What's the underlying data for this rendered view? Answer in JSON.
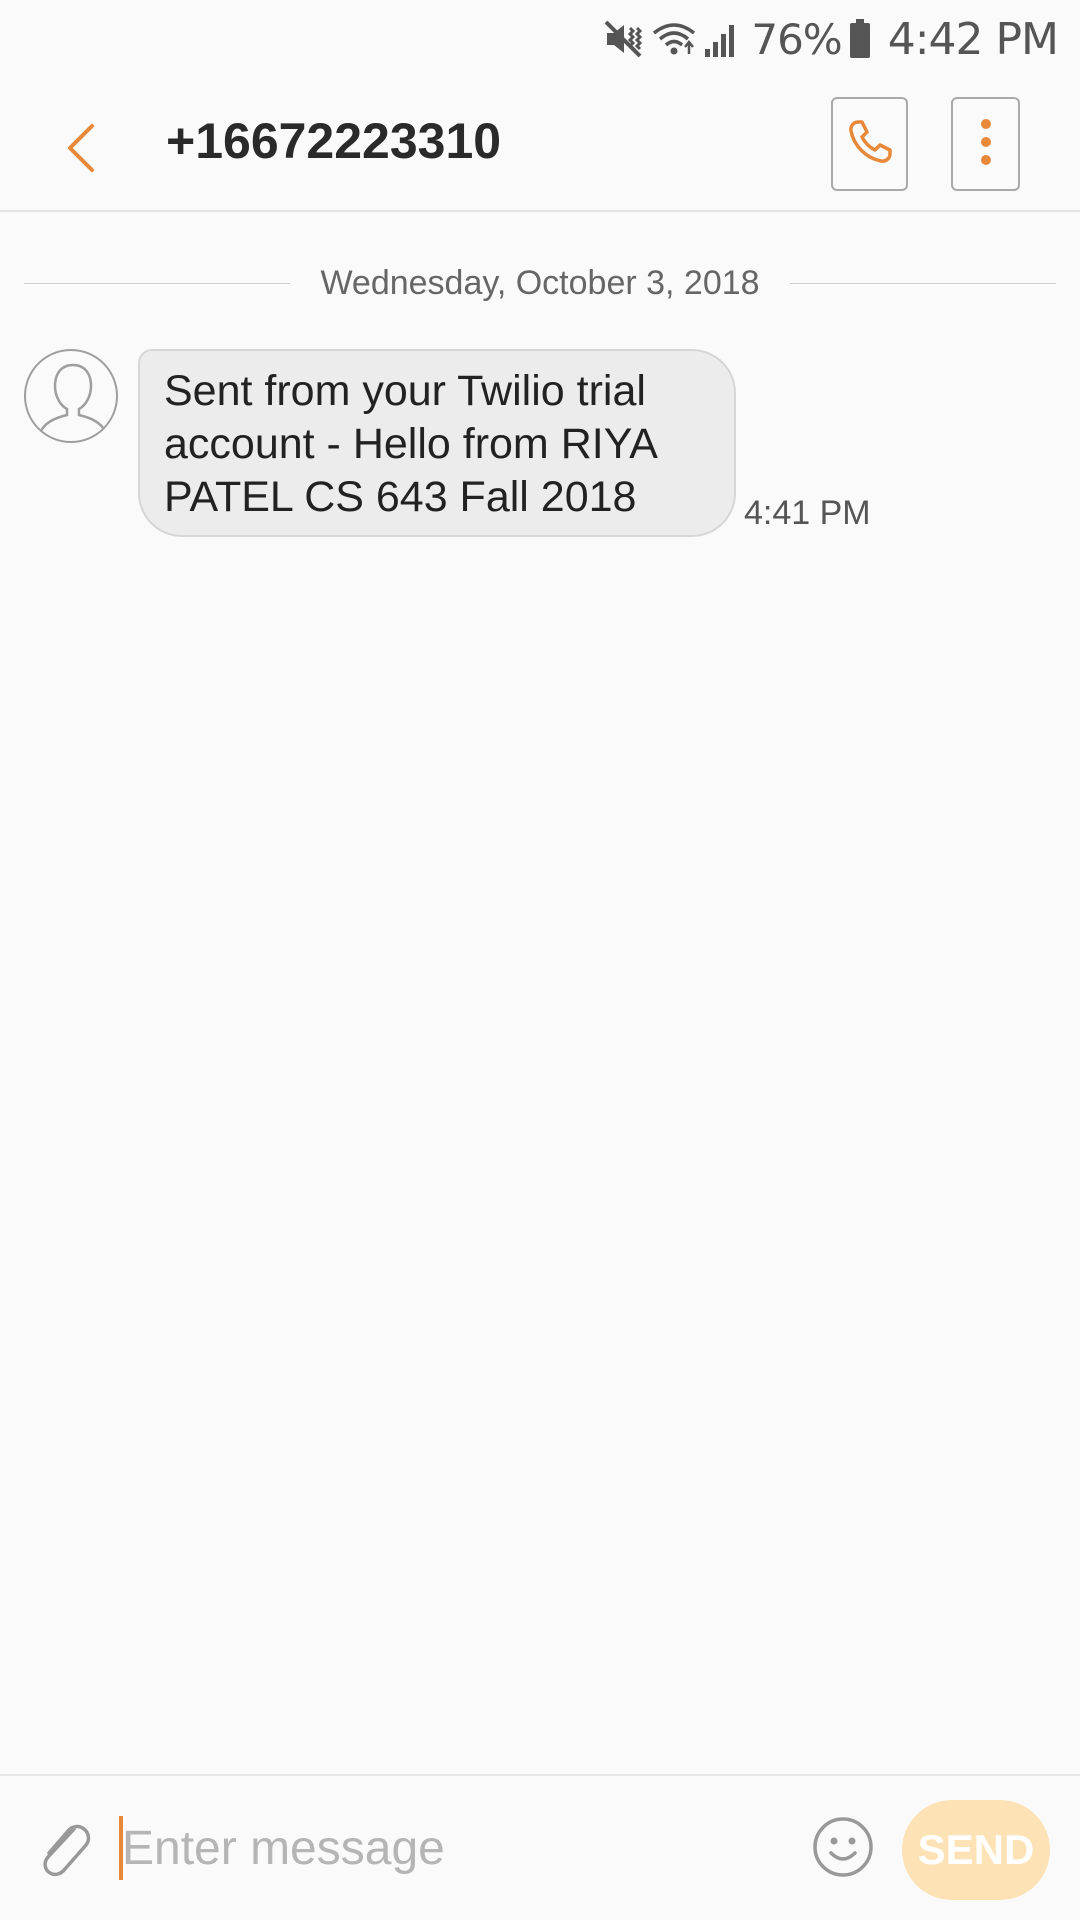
{
  "status_bar": {
    "battery_percent": "76%",
    "time": "4:42 PM",
    "icons": [
      "vibrate-mute-icon",
      "wifi-icon",
      "signal-icon",
      "battery-icon"
    ]
  },
  "header": {
    "title": "+16672223310",
    "back_icon": "chevron-left-icon",
    "call_icon": "phone-icon",
    "more_icon": "more-vertical-icon"
  },
  "conversation": {
    "date": "Wednesday, October 3, 2018",
    "messages": [
      {
        "direction": "incoming",
        "text": "Sent from your Twilio trial account - Hello from RIYA PATEL CS 643 Fall 2018",
        "time": "4:41 PM",
        "avatar_icon": "person-silhouette-icon"
      }
    ]
  },
  "composer": {
    "placeholder": "Enter message",
    "value": "",
    "send_label": "SEND",
    "attach_icon": "paperclip-icon",
    "emoji_icon": "smiley-icon"
  },
  "colors": {
    "accent": "#e8893a",
    "send_disabled": "#fde2b5",
    "bubble_incoming": "#ececec",
    "background": "#fafafa"
  }
}
